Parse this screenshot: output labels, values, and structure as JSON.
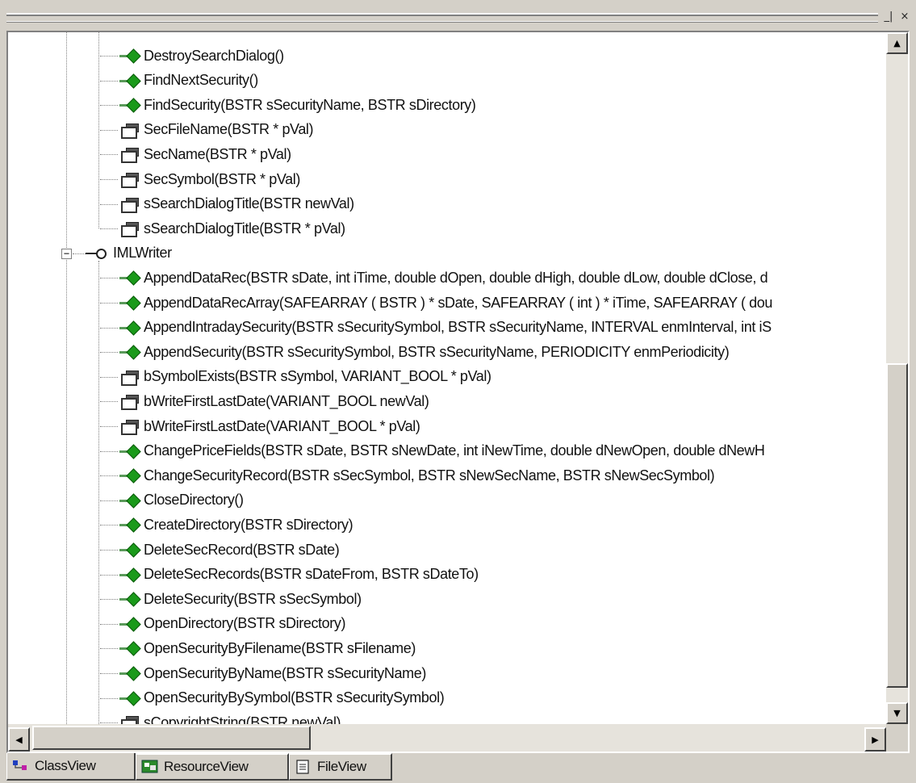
{
  "window": {
    "minimize_glyph": "_|",
    "close_glyph": "×"
  },
  "tree": {
    "group_top": [
      {
        "type": "method",
        "label": "DestroySearchDialog()"
      },
      {
        "type": "method",
        "label": "FindNextSecurity()"
      },
      {
        "type": "method",
        "label": "FindSecurity(BSTR sSecurityName, BSTR sDirectory)"
      },
      {
        "type": "property",
        "label": "SecFileName(BSTR * pVal)"
      },
      {
        "type": "property",
        "label": "SecName(BSTR * pVal)"
      },
      {
        "type": "property",
        "label": "SecSymbol(BSTR * pVal)"
      },
      {
        "type": "property",
        "label": "sSearchDialogTitle(BSTR newVal)"
      },
      {
        "type": "property",
        "label": "sSearchDialogTitle(BSTR * pVal)"
      }
    ],
    "interface_node": {
      "label": "IMLWriter",
      "expander": "−"
    },
    "group_writer": [
      {
        "type": "method",
        "label": "AppendDataRec(BSTR sDate, int iTime, double dOpen, double dHigh, double dLow, double dClose, d"
      },
      {
        "type": "method",
        "label": "AppendDataRecArray(SAFEARRAY ( BSTR ) * sDate, SAFEARRAY ( int ) * iTime, SAFEARRAY ( dou"
      },
      {
        "type": "method",
        "label": "AppendIntradaySecurity(BSTR sSecuritySymbol, BSTR sSecurityName, INTERVAL enmInterval, int iS"
      },
      {
        "type": "method",
        "label": "AppendSecurity(BSTR sSecuritySymbol, BSTR sSecurityName, PERIODICITY enmPeriodicity)"
      },
      {
        "type": "property",
        "label": "bSymbolExists(BSTR sSymbol, VARIANT_BOOL * pVal)"
      },
      {
        "type": "property",
        "label": "bWriteFirstLastDate(VARIANT_BOOL newVal)"
      },
      {
        "type": "property",
        "label": "bWriteFirstLastDate(VARIANT_BOOL * pVal)"
      },
      {
        "type": "method",
        "label": "ChangePriceFields(BSTR sDate, BSTR sNewDate, int iNewTime, double dNewOpen, double dNewH"
      },
      {
        "type": "method",
        "label": "ChangeSecurityRecord(BSTR sSecSymbol, BSTR sNewSecName, BSTR sNewSecSymbol)"
      },
      {
        "type": "method",
        "label": "CloseDirectory()"
      },
      {
        "type": "method",
        "label": "CreateDirectory(BSTR sDirectory)"
      },
      {
        "type": "method",
        "label": "DeleteSecRecord(BSTR sDate)"
      },
      {
        "type": "method",
        "label": "DeleteSecRecords(BSTR sDateFrom, BSTR sDateTo)"
      },
      {
        "type": "method",
        "label": "DeleteSecurity(BSTR sSecSymbol)"
      },
      {
        "type": "method",
        "label": "OpenDirectory(BSTR sDirectory)"
      },
      {
        "type": "method",
        "label": "OpenSecurityByFilename(BSTR sFilename)"
      },
      {
        "type": "method",
        "label": "OpenSecurityByName(BSTR sSecurityName)"
      },
      {
        "type": "method",
        "label": "OpenSecurityBySymbol(BSTR sSecuritySymbol)"
      },
      {
        "type": "property",
        "label": "sCopyrightString(BSTR newVal)"
      }
    ]
  },
  "tabs": [
    {
      "label": "ClassView",
      "icon": "class-view-icon",
      "active": true
    },
    {
      "label": "ResourceView",
      "icon": "resource-view-icon",
      "active": false
    },
    {
      "label": "FileView",
      "icon": "file-view-icon",
      "active": false
    }
  ],
  "scrollbar": {
    "up_glyph": "▲",
    "down_glyph": "▼",
    "left_glyph": "◀",
    "right_glyph": "▶"
  },
  "colors": {
    "method_icon": "#1a9a1a",
    "face": "#d4d0c8",
    "window": "#ffffff"
  }
}
